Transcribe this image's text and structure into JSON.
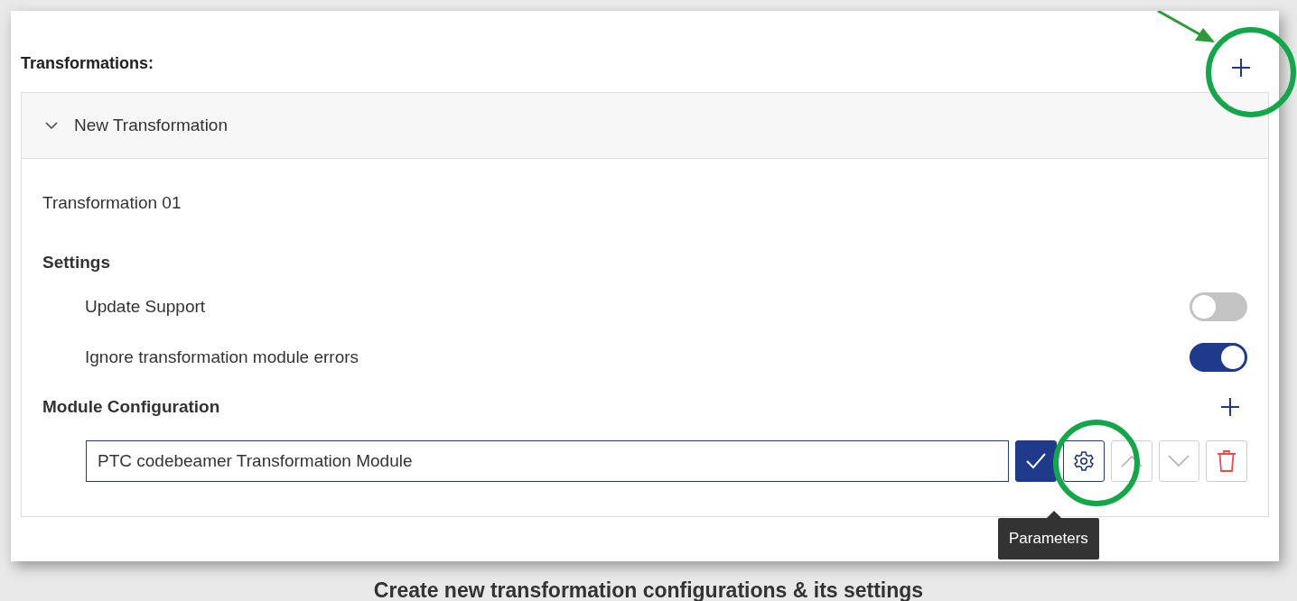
{
  "section": {
    "title": "Transformations:"
  },
  "transformation": {
    "title": "New Transformation",
    "expanded": true,
    "name": "Transformation 01",
    "settings_label": "Settings",
    "settings": [
      {
        "label": "Update Support",
        "on": false
      },
      {
        "label": "Ignore transformation module errors",
        "on": true
      }
    ],
    "module_configuration": {
      "label": "Module Configuration",
      "value": "PTC codebeamer Transformation Module",
      "actions": [
        {
          "kind": "confirm",
          "disabled": false
        },
        {
          "kind": "parameters",
          "disabled": false
        },
        {
          "kind": "move_up",
          "disabled": true
        },
        {
          "kind": "move_down",
          "disabled": true
        },
        {
          "kind": "delete",
          "disabled": false
        }
      ]
    },
    "tooltip": "Parameters"
  },
  "caption": "Create new transformation configurations & its settings"
}
